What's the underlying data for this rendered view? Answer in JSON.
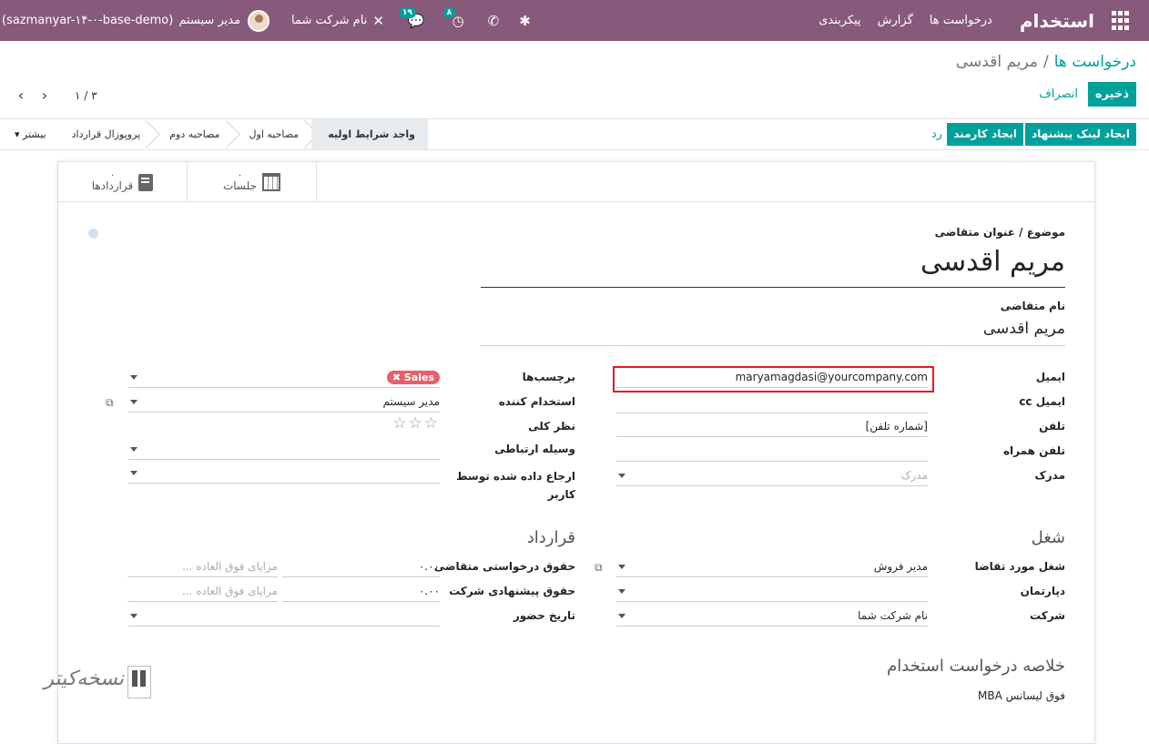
{
  "navbar": {
    "brand": "استخدام",
    "menu": [
      "درخواست ها",
      "گزارش",
      "پیکربندی"
    ],
    "company": "نام شرکت شما",
    "user": "مدیر سیستم",
    "database": "(sazmanyar-۱۴-۰-base-demo)",
    "activity_count": "۸",
    "messages_count": "۱۹",
    "accent_color": "#875A7B"
  },
  "control_panel": {
    "breadcrumb_parent": "درخواست ها",
    "breadcrumb_current": "مریم اقدسی",
    "save_label": "ذخیره",
    "discard_label": "انصراف",
    "pager_value": "۱ / ۳"
  },
  "statusbar": {
    "create_offer_link": "ایجاد لینک پیشنهاد",
    "create_employee": "ایجاد کارمند",
    "refuse": "رد",
    "stages": [
      "واجد شرایط اولیه",
      "مصاحبه اول",
      "مصاحبه دوم",
      "پروپوزال قرارداد"
    ],
    "active_stage": "واجد شرایط اولیه",
    "more": "بیشتر"
  },
  "smart_buttons": {
    "meetings_label": "جلسات",
    "meetings_count": "۰",
    "contracts_label": "قراردادها",
    "contracts_count": "۰"
  },
  "form": {
    "subject_label": "موضوع / عنوان متقاضی",
    "subject_value": "مریم اقدسی",
    "applicant_name_label": "نام متقاضی",
    "applicant_name_value": "مریم اقدسی",
    "email_label": "ایمیل",
    "email_value": "maryamagdasi@yourcompany.com",
    "email_cc_label": "ایمیل cc",
    "phone_label": "تلفن",
    "phone_value": "[شماره تلفن]",
    "mobile_label": "تلفن همراه",
    "degree_label": "مدرک",
    "degree_placeholder": "مدرک",
    "tags_label": "برچسب‌ها",
    "tag_value": "Sales",
    "recruiter_label": "استخدام کننده",
    "recruiter_value": "مدیر سیستم",
    "evaluation_label": "نظر کلی",
    "medium_label": "وسیله ارتباطی",
    "referred_label_1": "ارجاع داده شده توسط",
    "referred_label_2": "کاربر",
    "job_section": "شغل",
    "contract_section": "قرارداد",
    "job_label": "شغل مورد تقاضا",
    "job_value": "مدیر فروش",
    "department_label": "دپارتمان",
    "company_label": "شرکت",
    "company_value": "نام شرکت شما",
    "expected_salary_label": "حقوق درخواستی متقاضی",
    "expected_salary_value": "۰.۰۰",
    "proposed_salary_label": "حقوق پیشنهادی شرکت",
    "proposed_salary_value": "۰.۰۰",
    "extra_advantages_placeholder": "مزایای فوق العاده ...",
    "availability_label": "تاریخ حضور",
    "summary_section": "خلاصه درخواست استخدام",
    "summary_value": "فوق لیسانس MBA"
  },
  "watermark": {
    "text": "نسخه‌کیتر"
  }
}
